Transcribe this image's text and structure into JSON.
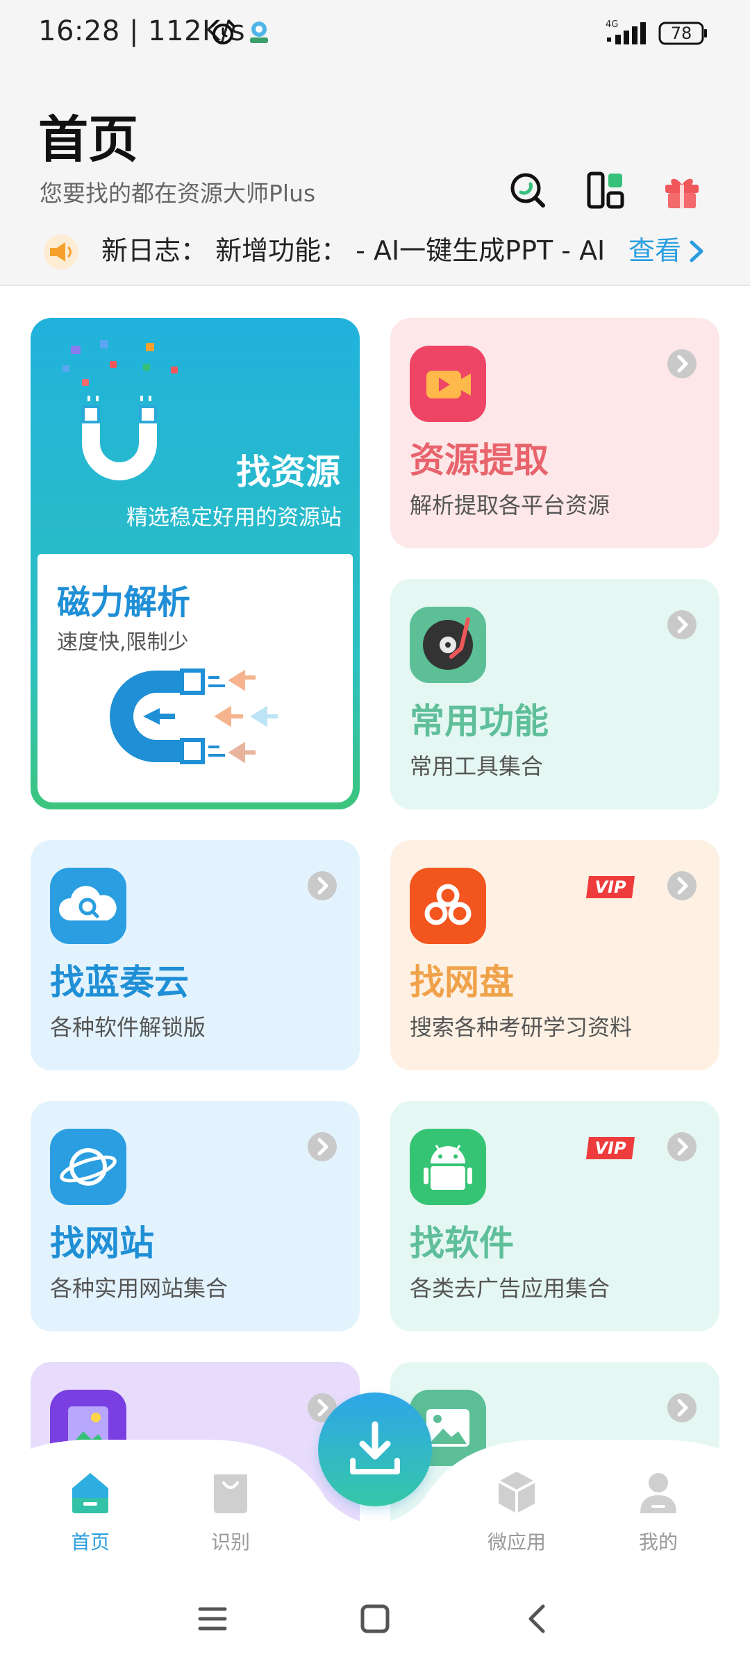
{
  "status": {
    "time": "16:28 | 112K/s",
    "network": "4G",
    "battery": "78"
  },
  "header": {
    "title": "首页",
    "subtitle": "您要找的都在资源大师Plus",
    "icons": [
      "search-icon",
      "layout-grid-icon",
      "gift-icon"
    ]
  },
  "changelog": {
    "text": "新日志： 新增功能：  - AI一键生成PPT - AI",
    "view_label": "查看"
  },
  "big_card": {
    "title": "找资源",
    "subtitle": "精选稳定好用的资源站",
    "inner_title": "磁力解析",
    "inner_subtitle": "速度快,限制少"
  },
  "cards": {
    "extract": {
      "title": "资源提取",
      "subtitle": "解析提取各平台资源",
      "title_color": "#e8636b"
    },
    "common": {
      "title": "常用功能",
      "subtitle": "常用工具集合",
      "title_color": "#5fbf9a"
    },
    "lanzou": {
      "title": "找蓝奏云",
      "subtitle": "各种软件解锁版",
      "title_color": "#1f8fd6"
    },
    "netdisk": {
      "title": "找网盘",
      "subtitle": "搜索各种考研学习资料",
      "title_color": "#f0a24a",
      "badge": "VIP"
    },
    "website": {
      "title": "找网站",
      "subtitle": "各种实用网站集合",
      "title_color": "#1f8fd6"
    },
    "software": {
      "title": "找软件",
      "subtitle": "各类去广告应用集合",
      "title_color": "#5fbf9a",
      "badge": "VIP"
    }
  },
  "bottom_nav": {
    "items": [
      {
        "label": "首页",
        "icon": "home-icon",
        "active": true
      },
      {
        "label": "识别",
        "icon": "bag-icon",
        "active": false
      },
      {
        "label": "微应用",
        "icon": "cube-icon",
        "active": false
      },
      {
        "label": "我的",
        "icon": "user-icon",
        "active": false
      }
    ],
    "fab_icon": "download-icon"
  },
  "colors": {
    "accent": "#2a9ee0",
    "extract_bg": "#fde7e8",
    "common_bg": "#e5f7f3",
    "lanzou_bg": "#e3f3fd",
    "netdisk_bg": "#fef1e4",
    "website_bg": "#e3f3fd",
    "software_bg": "#e5f7f3",
    "purple_bg": "#e7dcfc"
  }
}
